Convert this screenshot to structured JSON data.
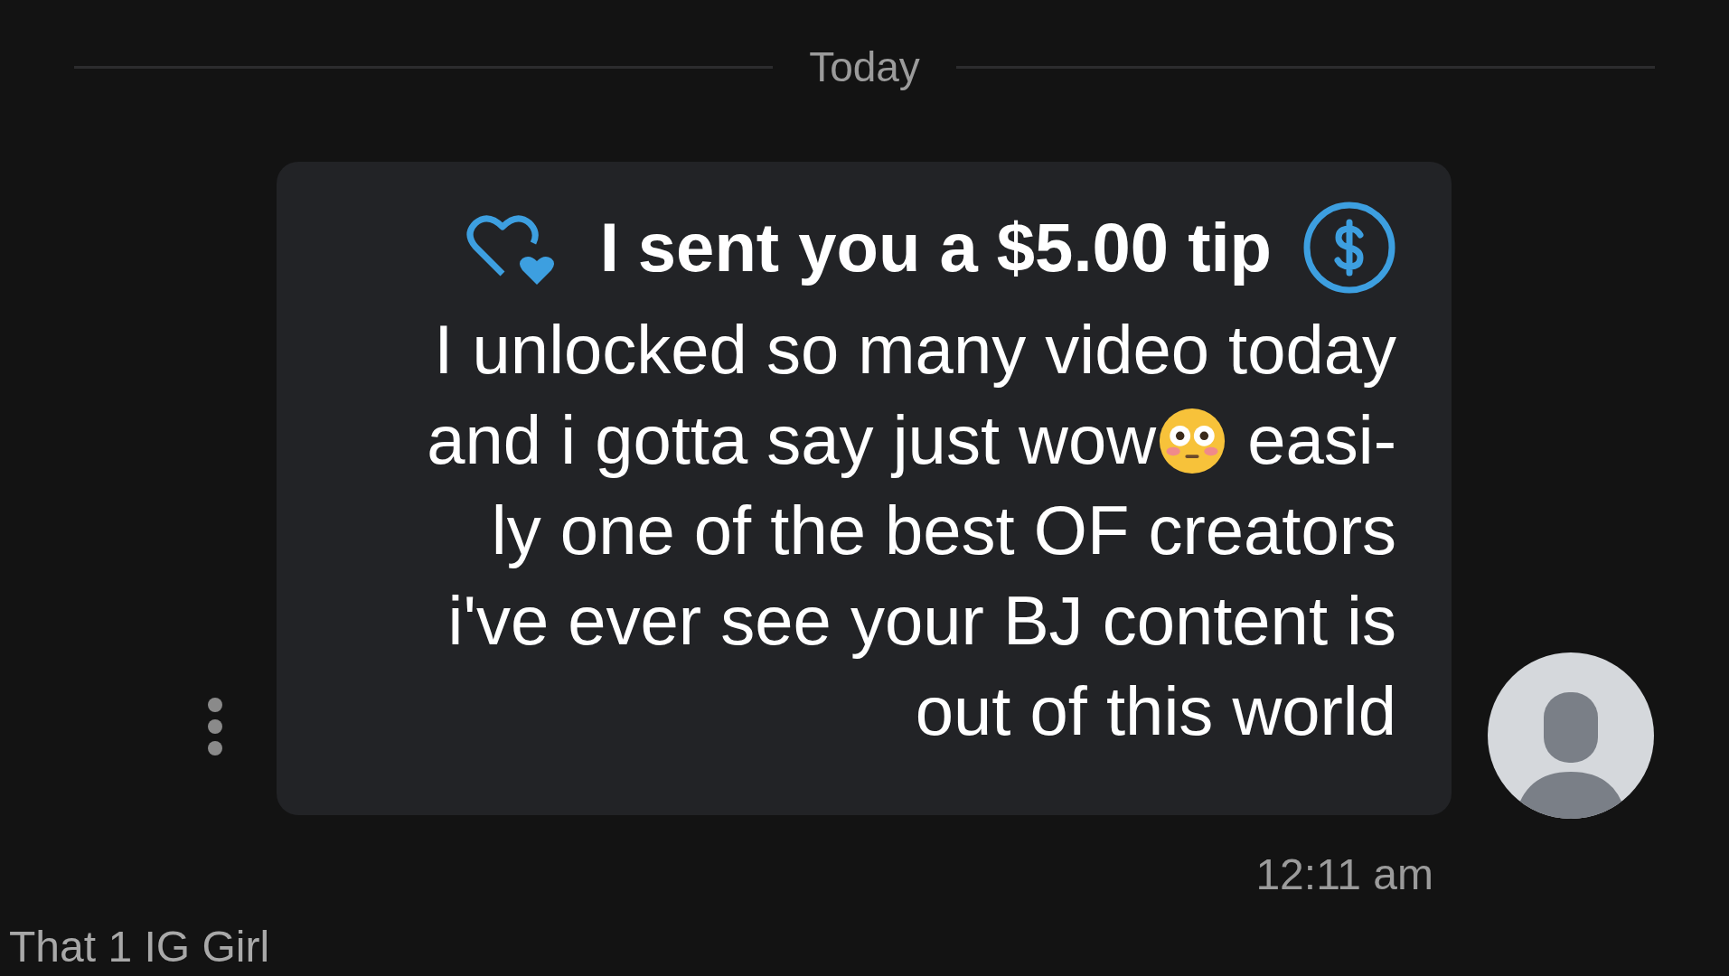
{
  "date_divider": "Today",
  "message": {
    "title": "I sent you a $5.00 tip",
    "lines": [
      [
        {
          "kind": "text",
          "text": "I unlocked so many video today"
        }
      ],
      [
        {
          "kind": "text",
          "text": "and i gotta say just wow"
        },
        {
          "kind": "emoji"
        },
        {
          "kind": "text",
          "text": " easi-"
        }
      ],
      [
        {
          "kind": "text",
          "text": "ly one of the best OF creators"
        }
      ],
      [
        {
          "kind": "text",
          "text": "i've ever see your BJ content is"
        }
      ],
      [
        {
          "kind": "text",
          "text": "out of this world"
        }
      ]
    ],
    "time": "12:11 am"
  },
  "sender": "That 1 IG Girl"
}
